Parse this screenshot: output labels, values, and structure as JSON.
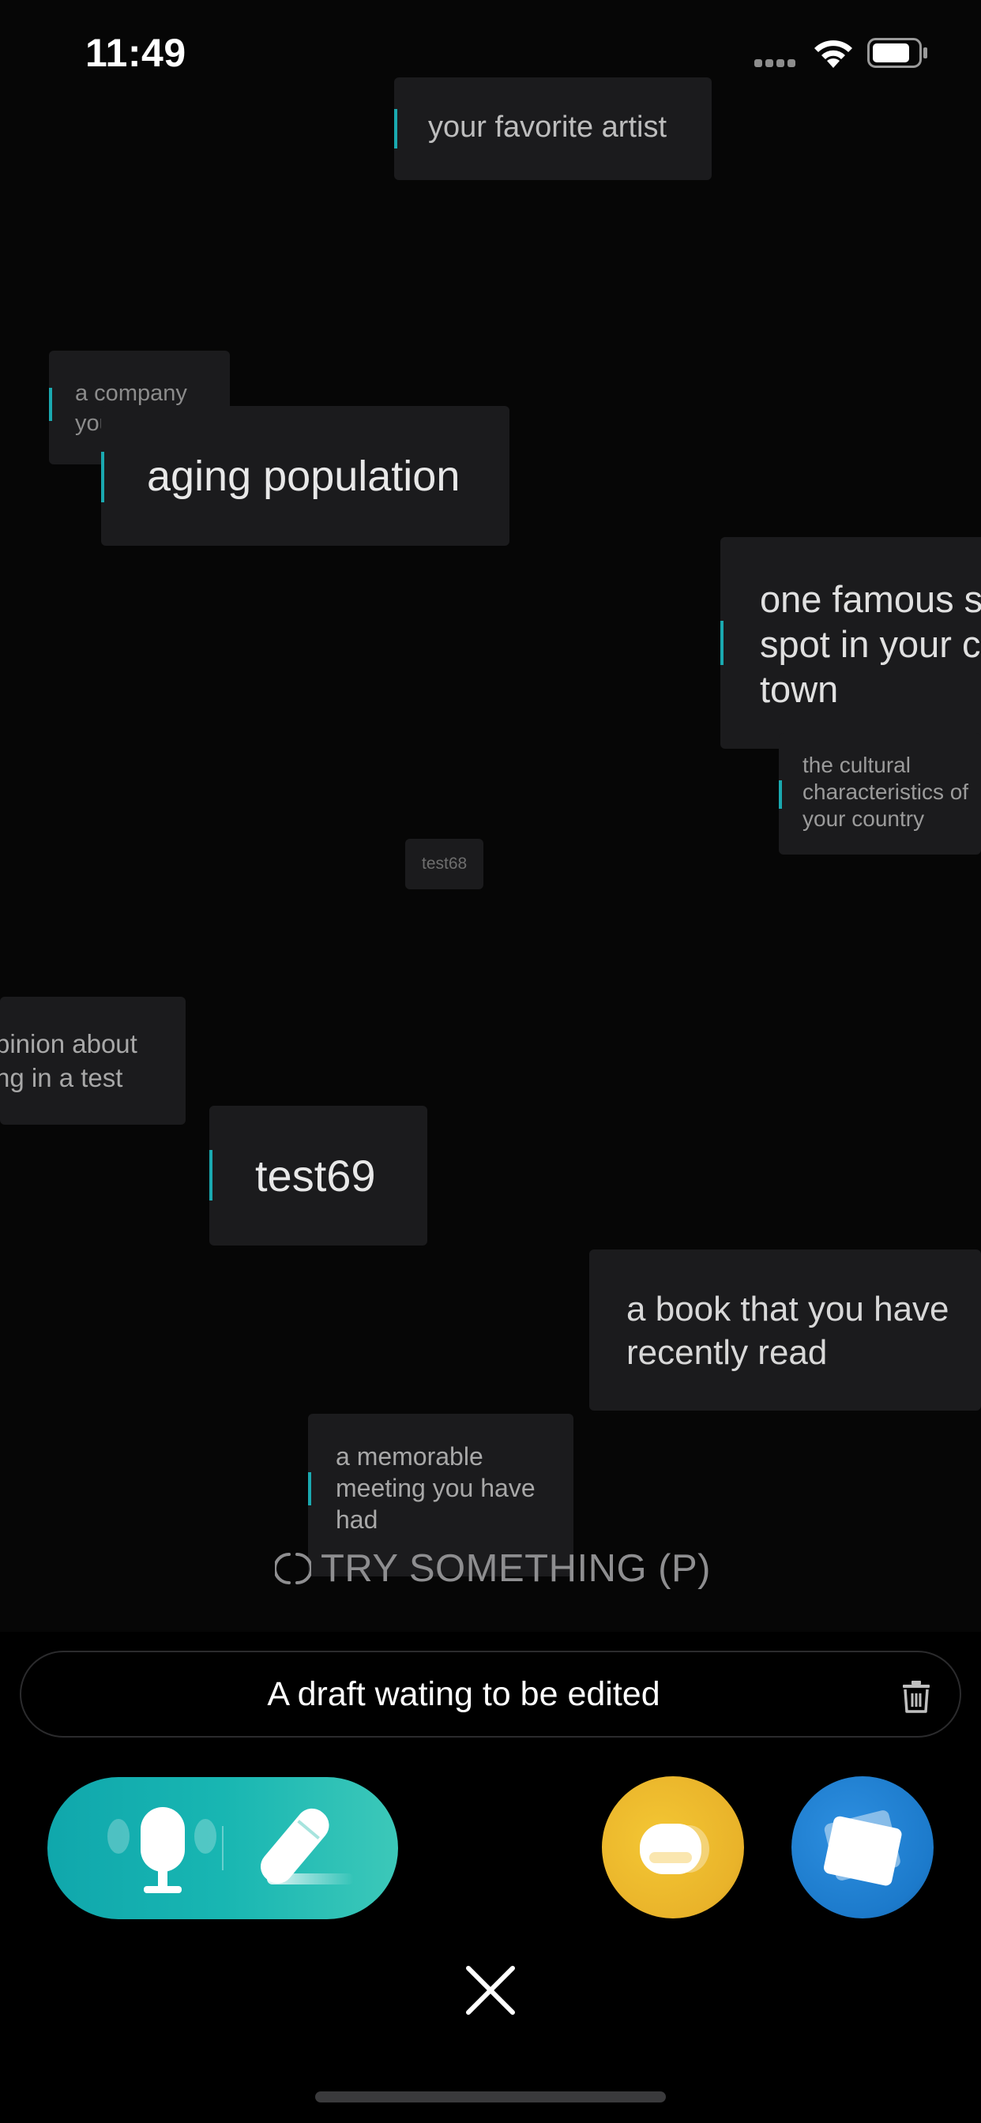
{
  "status": {
    "time": "11:49",
    "signal_icon": "signal-dots-icon",
    "wifi_icon": "wifi-icon",
    "battery_icon": "battery-icon"
  },
  "topics": [
    {
      "text": "your favorite artist"
    },
    {
      "text": "a company\nyou admire"
    },
    {
      "text": "aging population"
    },
    {
      "text": "one famous s\nspot in your c\ntown"
    },
    {
      "text": "the cultural\ncharacteristics of\nyour country"
    },
    {
      "text": "test68"
    },
    {
      "text": "pinion about\nng in a test"
    },
    {
      "text": "test69"
    },
    {
      "text": "a book that you have\nrecently read"
    },
    {
      "text": "a memorable\nmeeting you have\nhad"
    }
  ],
  "try_button": {
    "label": "TRY SOMETHING (P)",
    "icon": "refresh-icon"
  },
  "draft": {
    "text": "A draft wating to be edited",
    "icon": "trash-icon"
  },
  "actions": {
    "mic_icon": "microphone-icon",
    "pen_icon": "eraser-pen-icon",
    "chat_icon": "chat-bubble-icon",
    "cards_icon": "cards-icon",
    "close_icon": "close-icon"
  },
  "colors": {
    "background": "#060606",
    "card": "#1b1b1d",
    "accent": "#1aa9b0",
    "teal_button": "#18b6b2",
    "yellow_button": "#e9b32a",
    "blue_button": "#1c7acb"
  }
}
